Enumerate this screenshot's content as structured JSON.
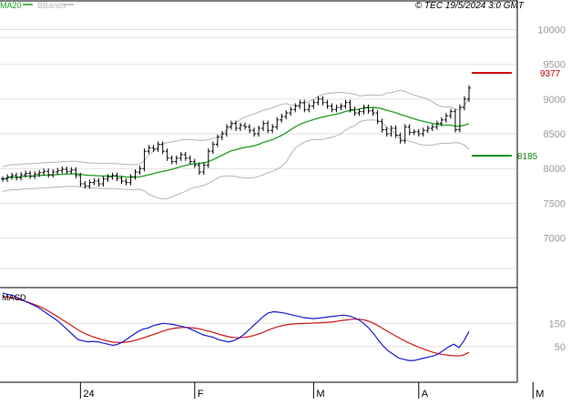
{
  "header": {
    "legend": [
      {
        "label": "MA20",
        "color": "#1a9e1a"
      },
      {
        "label": "BBands",
        "color": "#b8b8b8"
      }
    ],
    "copyright": "© TEC 19/5/2024 3:0 GMT"
  },
  "colors": {
    "ma": "#2aa52a",
    "bbands": "#b4b4b4",
    "price": "#000000",
    "resistance": "#cc0000",
    "support": "#1a8c1a",
    "macd": "#1a1ad6",
    "signal": "#cc1a1a",
    "grid": "#e2e2e2"
  },
  "chart_data": [
    {
      "type": "ohlc",
      "ylim": [
        6300,
        10400
      ],
      "y_ticks": [
        7000,
        7500,
        8000,
        8500,
        9000,
        9500,
        10000
      ],
      "y_tick_labels": [
        "7000",
        "7500",
        "8000",
        "8500",
        "9000",
        "9500",
        "10000"
      ],
      "x_ticks": [
        {
          "label": "24",
          "index": 17
        },
        {
          "label": "F",
          "index": 42
        },
        {
          "label": "M",
          "index": 68
        },
        {
          "label": "A",
          "index": 91
        },
        {
          "label": "M",
          "index": 116
        }
      ],
      "close": [
        7850,
        7880,
        7900,
        7870,
        7910,
        7930,
        7890,
        7920,
        7940,
        7960,
        7910,
        7950,
        7970,
        7990,
        7960,
        7980,
        7900,
        7780,
        7750,
        7800,
        7820,
        7780,
        7850,
        7880,
        7900,
        7860,
        7820,
        7800,
        7880,
        7950,
        8000,
        8250,
        8300,
        8280,
        8350,
        8250,
        8150,
        8100,
        8150,
        8200,
        8150,
        8100,
        8050,
        7950,
        8050,
        8250,
        8350,
        8450,
        8500,
        8600,
        8650,
        8580,
        8620,
        8600,
        8550,
        8500,
        8580,
        8650,
        8550,
        8600,
        8700,
        8750,
        8800,
        8850,
        8900,
        8950,
        8850,
        8900,
        8950,
        9000,
        8950,
        8900,
        8850,
        8880,
        8900,
        8950,
        8850,
        8800,
        8820,
        8880,
        8830,
        8800,
        8680,
        8560,
        8500,
        8580,
        8480,
        8400,
        8600,
        8520,
        8530,
        8500,
        8550,
        8580,
        8600,
        8650,
        8700,
        8760,
        8820,
        8560,
        8880,
        9000,
        9160
      ],
      "resistance": {
        "value": 9377,
        "label": "9377"
      },
      "support": {
        "value": 8185,
        "label": "8185"
      }
    },
    {
      "type": "line",
      "name": "MACD",
      "ylim": [
        -100,
        300
      ],
      "y_ticks": [
        50,
        150
      ],
      "y_tick_labels": [
        "50",
        "150"
      ],
      "macd": [
        280,
        275,
        270,
        260,
        250,
        240,
        230,
        220,
        205,
        190,
        175,
        160,
        140,
        120,
        100,
        80,
        75,
        70,
        72,
        70,
        65,
        60,
        55,
        60,
        70,
        85,
        100,
        115,
        125,
        130,
        140,
        145,
        150,
        148,
        145,
        140,
        135,
        130,
        120,
        110,
        100,
        95,
        90,
        80,
        75,
        70,
        75,
        85,
        100,
        120,
        140,
        160,
        180,
        195,
        200,
        198,
        195,
        190,
        185,
        180,
        175,
        172,
        170,
        172,
        175,
        178,
        180,
        183,
        185,
        182,
        175,
        165,
        150,
        130,
        105,
        75,
        50,
        30,
        15,
        0,
        -5,
        -10,
        -10,
        -5,
        0,
        5,
        10,
        20,
        35,
        50,
        60,
        45,
        75,
        115
      ],
      "signal": [
        265,
        263,
        260,
        255,
        248,
        242,
        234,
        226,
        216,
        204,
        191,
        178,
        164,
        150,
        136,
        122,
        110,
        100,
        92,
        85,
        79,
        73,
        69,
        67,
        67,
        70,
        74,
        80,
        87,
        94,
        101,
        109,
        117,
        123,
        128,
        131,
        132,
        132,
        130,
        127,
        122,
        117,
        111,
        104,
        98,
        92,
        89,
        88,
        89,
        92,
        97,
        104,
        112,
        121,
        129,
        136,
        141,
        145,
        147,
        149,
        149,
        150,
        151,
        152,
        153,
        155,
        157,
        160,
        163,
        166,
        168,
        168,
        165,
        159,
        150,
        138,
        125,
        112,
        100,
        88,
        77,
        66,
        56,
        47,
        39,
        31,
        24,
        19,
        15,
        12,
        10,
        9,
        14,
        25
      ]
    }
  ],
  "macd_panel": {
    "label": "MACD"
  }
}
